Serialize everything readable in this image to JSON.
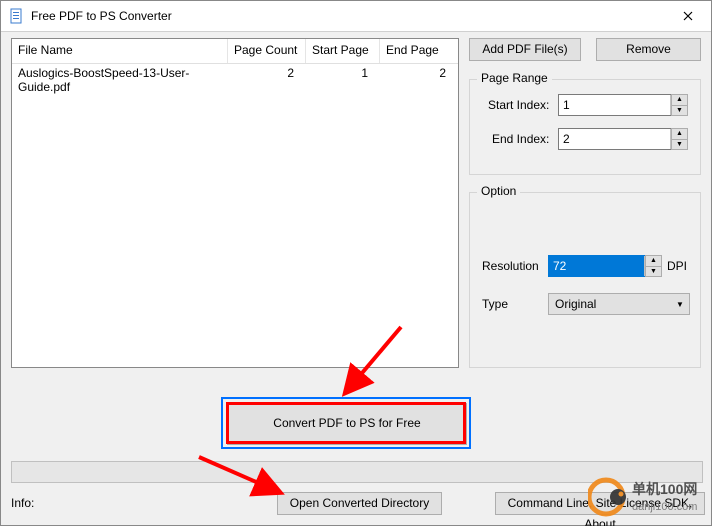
{
  "window": {
    "title": "Free PDF to PS Converter"
  },
  "filelist": {
    "columns": {
      "name": "File Name",
      "page_count": "Page Count",
      "start_page": "Start Page",
      "end_page": "End Page"
    },
    "rows": [
      {
        "name": "Auslogics-BoostSpeed-13-User-Guide.pdf",
        "page_count": "2",
        "start_page": "1",
        "end_page": "2"
      }
    ]
  },
  "buttons": {
    "add": "Add PDF File(s)",
    "remove": "Remove",
    "convert": "Convert PDF to PS for Free",
    "open_dir": "Open Converted Directory",
    "about": "Command Line, Site License SDK, About"
  },
  "page_range": {
    "legend": "Page Range",
    "start_label": "Start Index:",
    "start_value": "1",
    "end_label": "End Index:",
    "end_value": "2"
  },
  "option": {
    "legend": "Option",
    "resolution_label": "Resolution",
    "resolution_value": "72",
    "resolution_unit": "DPI",
    "type_label": "Type",
    "type_value": "Original"
  },
  "info_label": "Info:",
  "watermark": {
    "text1": "单机100网",
    "text2": "danji100.com"
  }
}
